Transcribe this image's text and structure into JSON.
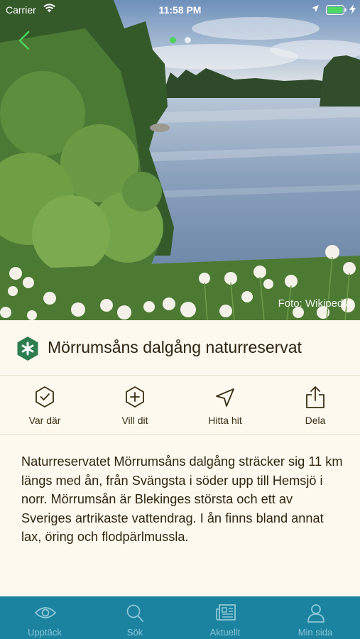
{
  "status_bar": {
    "carrier": "Carrier",
    "time": "11:58 PM"
  },
  "hero": {
    "photo_credit": "Foto: Wikipedia",
    "page_count": 2,
    "active_page": 1
  },
  "place": {
    "title": "Mörrumsåns dalgång naturreservat",
    "category_icon": "asterisk-hexagon-icon",
    "category_color": "#2e7d4f"
  },
  "actions": [
    {
      "label": "Var där",
      "icon": "check-circle-icon"
    },
    {
      "label": "Vill dit",
      "icon": "plus-circle-icon"
    },
    {
      "label": "Hitta hit",
      "icon": "navigation-arrow-icon"
    },
    {
      "label": "Dela",
      "icon": "share-icon"
    }
  ],
  "description": "Naturreservatet Mörrumsåns dalgång sträcker sig 11 km längs med ån, från Svängsta i söder upp till Hemsjö i norr. Mörrumsån är Blekinges största och ett av Sveriges artrikaste vattendrag. I ån finns bland annat lax, öring och flodpärlmussla.",
  "tabbar": {
    "background": "#1b83a0",
    "tabs": [
      {
        "label": "Upptäck",
        "icon": "eye-icon"
      },
      {
        "label": "Sök",
        "icon": "search-icon"
      },
      {
        "label": "Aktuellt",
        "icon": "newspaper-icon"
      },
      {
        "label": "Min sida",
        "icon": "person-icon"
      }
    ]
  }
}
